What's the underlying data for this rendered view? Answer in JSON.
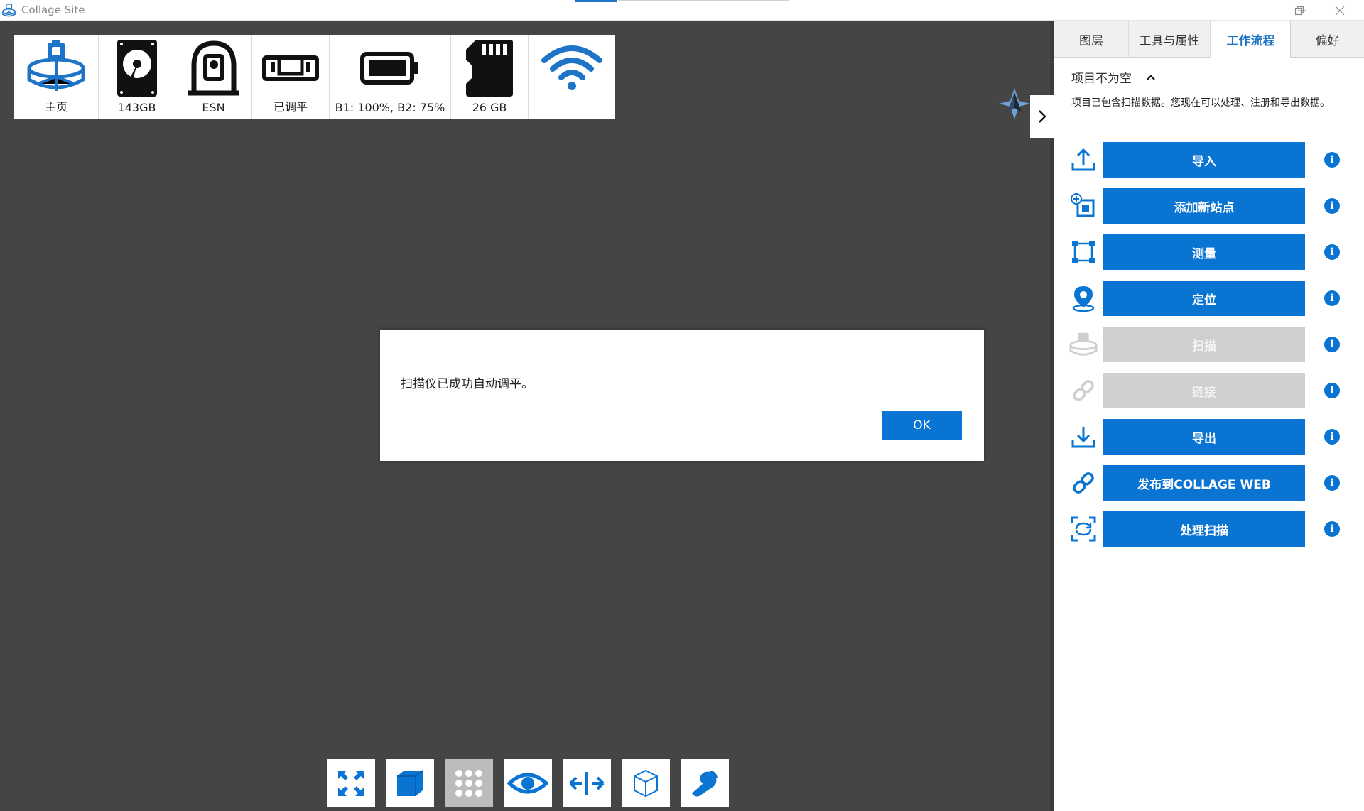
{
  "window": {
    "title": "Collage Site"
  },
  "status_bar": [
    {
      "icon": "scanner-home-icon",
      "label": "主页"
    },
    {
      "icon": "hard-drive-icon",
      "label": "143GB"
    },
    {
      "icon": "scanner-esn-icon",
      "label": "ESN"
    },
    {
      "icon": "level-icon",
      "label": "已调平"
    },
    {
      "icon": "battery-icon",
      "label": "B1: 100%, B2: 75%"
    },
    {
      "icon": "sd-card-icon",
      "label": "26 GB"
    },
    {
      "icon": "wifi-icon",
      "label": ""
    }
  ],
  "dialog": {
    "message": "扫描仪已成功自动调平。",
    "ok_label": "OK"
  },
  "panel": {
    "tabs": [
      {
        "label": "图层",
        "active": false
      },
      {
        "label": "工具与属性",
        "active": false
      },
      {
        "label": "工作流程",
        "active": true
      },
      {
        "label": "偏好",
        "active": false
      }
    ],
    "section_title": "项目不为空",
    "section_desc": "项目已包含扫描数据。您现在可以处理、注册和导出数据。",
    "workflow": [
      {
        "icon": "import-icon",
        "label": "导入",
        "enabled": true
      },
      {
        "icon": "add-station-icon",
        "label": "添加新站点",
        "enabled": true
      },
      {
        "icon": "measure-icon",
        "label": "测量",
        "enabled": true
      },
      {
        "icon": "locate-icon",
        "label": "定位",
        "enabled": true
      },
      {
        "icon": "scan-icon",
        "label": "扫描",
        "enabled": false
      },
      {
        "icon": "link-icon",
        "label": "链接",
        "enabled": false
      },
      {
        "icon": "export-icon",
        "label": "导出",
        "enabled": true
      },
      {
        "icon": "publish-icon",
        "label": "发布到COLLAGE WEB",
        "enabled": true
      },
      {
        "icon": "process-scan-icon",
        "label": "处理扫描",
        "enabled": true
      }
    ]
  },
  "bottom_toolbar": [
    {
      "icon": "fit-view-icon",
      "active": false
    },
    {
      "icon": "3d-view-icon",
      "active": false
    },
    {
      "icon": "points-grid-icon",
      "active": true
    },
    {
      "icon": "eye-icon",
      "active": false
    },
    {
      "icon": "split-view-icon",
      "active": false
    },
    {
      "icon": "wireframe-cube-icon",
      "active": false
    },
    {
      "icon": "wrench-icon",
      "active": false
    }
  ],
  "colors": {
    "accent": "#0a74d3",
    "viewport_bg": "#454545",
    "disabled": "#cfcfcf"
  }
}
